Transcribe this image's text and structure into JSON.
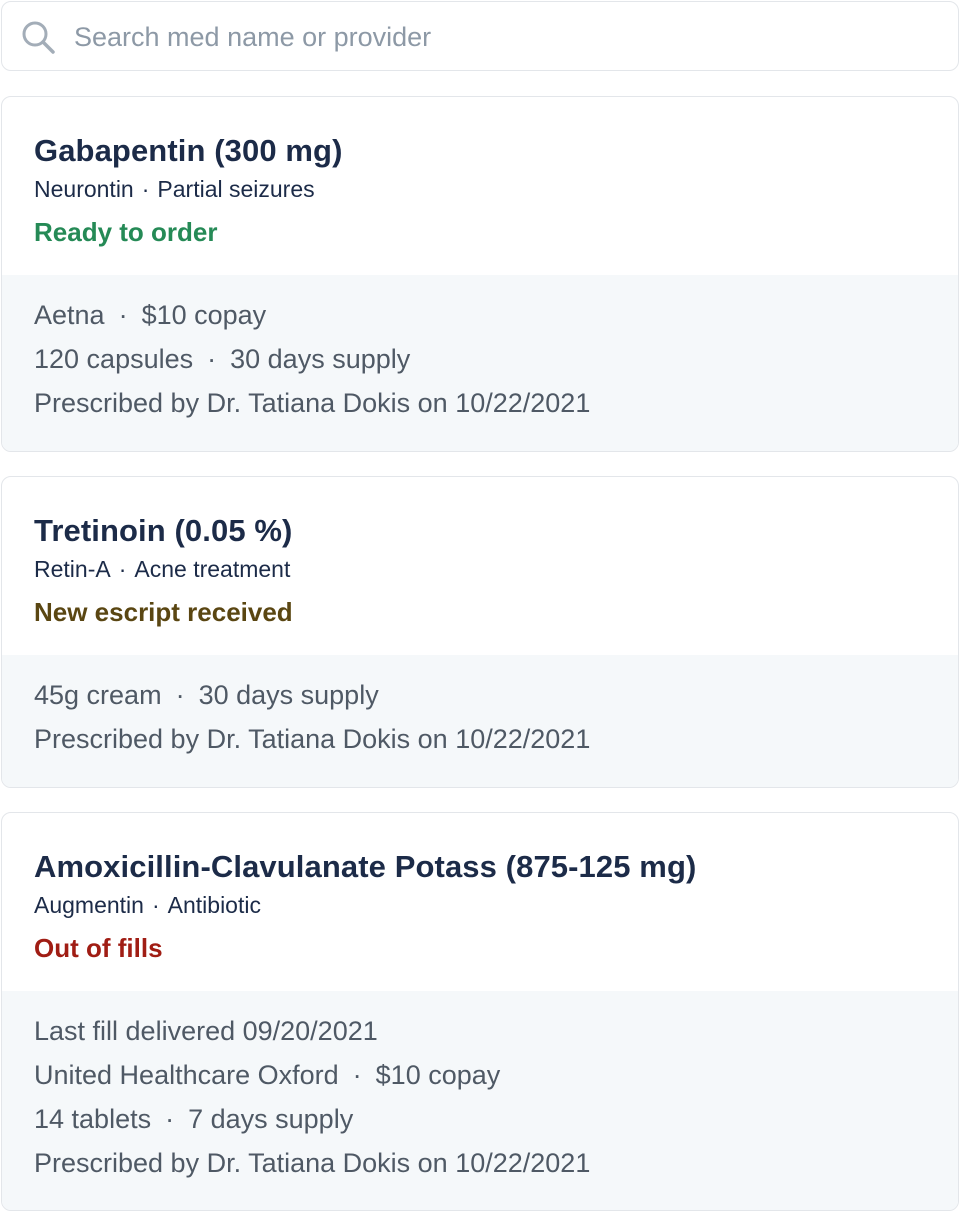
{
  "search": {
    "placeholder": "Search med name or provider",
    "icon": "search-icon"
  },
  "medications": [
    {
      "title": "Gabapentin (300 mg)",
      "brand": "Neurontin",
      "indication": "Partial seizures",
      "status": "Ready to order",
      "status_color": "#258a56",
      "insurance": "Aetna",
      "copay": "$10 copay",
      "quantity": "120 capsules",
      "supply": "30 days supply",
      "prescribed": "Prescribed by Dr. Tatiana Dokis on 10/22/2021"
    },
    {
      "title": "Tretinoin (0.05 %)",
      "brand": "Retin-A",
      "indication": "Acne treatment",
      "status": "New escript received",
      "status_color": "#5a4612",
      "quantity": "45g cream",
      "supply": "30 days supply",
      "prescribed": "Prescribed by Dr. Tatiana Dokis on 10/22/2021"
    },
    {
      "title": "Amoxicillin-Clavulanate Potass (875-125 mg)",
      "brand": "Augmentin",
      "indication": "Antibiotic",
      "status": "Out of fills",
      "status_color": "#a01d14",
      "last_fill": "Last fill delivered 09/20/2021",
      "insurance": "United Healthcare Oxford",
      "copay": "$10 copay",
      "quantity": "14 tablets",
      "supply": "7 days supply",
      "prescribed": "Prescribed by Dr. Tatiana Dokis on 10/22/2021"
    }
  ],
  "separator": "·"
}
